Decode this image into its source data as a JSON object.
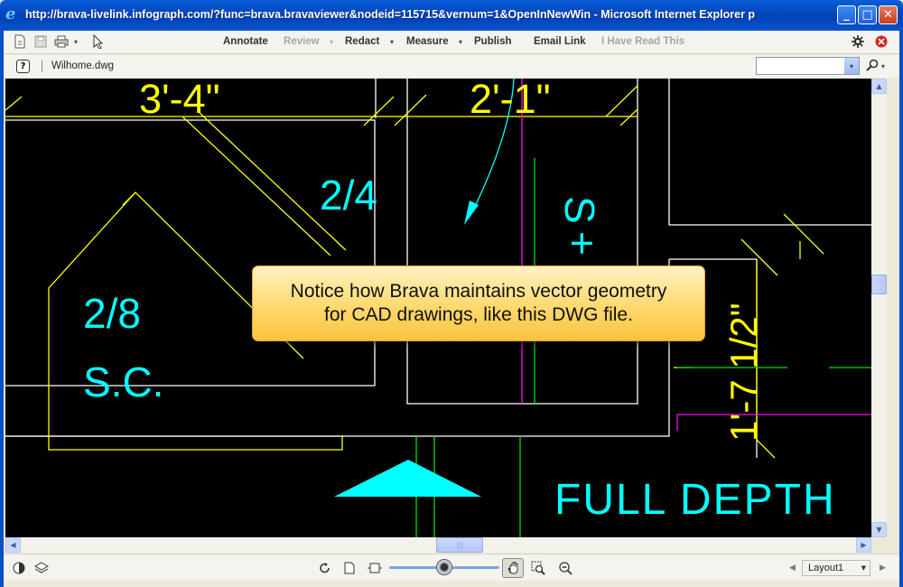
{
  "window": {
    "title": "http://brava-livelink.infograph.com/?func=brava.bravaviewer&nodeid=115715&vernum=1&OpenInNewWin - Microsoft Internet Explorer p",
    "logo_glyph": "e",
    "min_glyph": "_",
    "max_glyph": "□",
    "close_glyph": "✕"
  },
  "toolbar": {
    "menu": [
      {
        "label": "Annotate",
        "enabled": true,
        "has_menu": false
      },
      {
        "label": "Review",
        "enabled": false,
        "has_menu": true
      },
      {
        "label": "Redact",
        "enabled": true,
        "has_menu": true
      },
      {
        "label": "Measure",
        "enabled": true,
        "has_menu": true
      },
      {
        "label": "Publish",
        "enabled": true,
        "has_menu": false
      },
      {
        "label": "Email Link",
        "enabled": true,
        "has_menu": false
      },
      {
        "label": "I Have Read This",
        "enabled": false,
        "has_menu": false
      }
    ],
    "caret": "▾",
    "icons": [
      "open-file-icon",
      "save-icon",
      "print-icon",
      "select-pointer-icon",
      "settings-icon",
      "close-icon"
    ]
  },
  "docbar": {
    "help_glyph": "?",
    "filename": "Wilhome.dwg",
    "search_value": ""
  },
  "drawing": {
    "labels": {
      "dim_top_left": "3'-4\"",
      "dim_top_right": "2'-1\"",
      "room_a": "2/4",
      "room_b": "2/8",
      "room_b_sub": "S.C.",
      "vertical_s": "S",
      "vertical_plus": "+",
      "dim_vertical": "1'-7 1/2\"",
      "full_depth": "FULL DEPTH"
    },
    "colors": {
      "dimension": "#ffff00",
      "room_text": "#00ffff",
      "linework": "#ffffff",
      "guide_green": "#00e000",
      "guide_magenta": "#ff00ff",
      "background": "#000000"
    }
  },
  "callout": {
    "line1": "Notice how Brava maintains vector geometry",
    "line2": "for CAD drawings, like this DWG file."
  },
  "statusbar": {
    "layout": "Layout1",
    "zoom_level": 0.5
  }
}
